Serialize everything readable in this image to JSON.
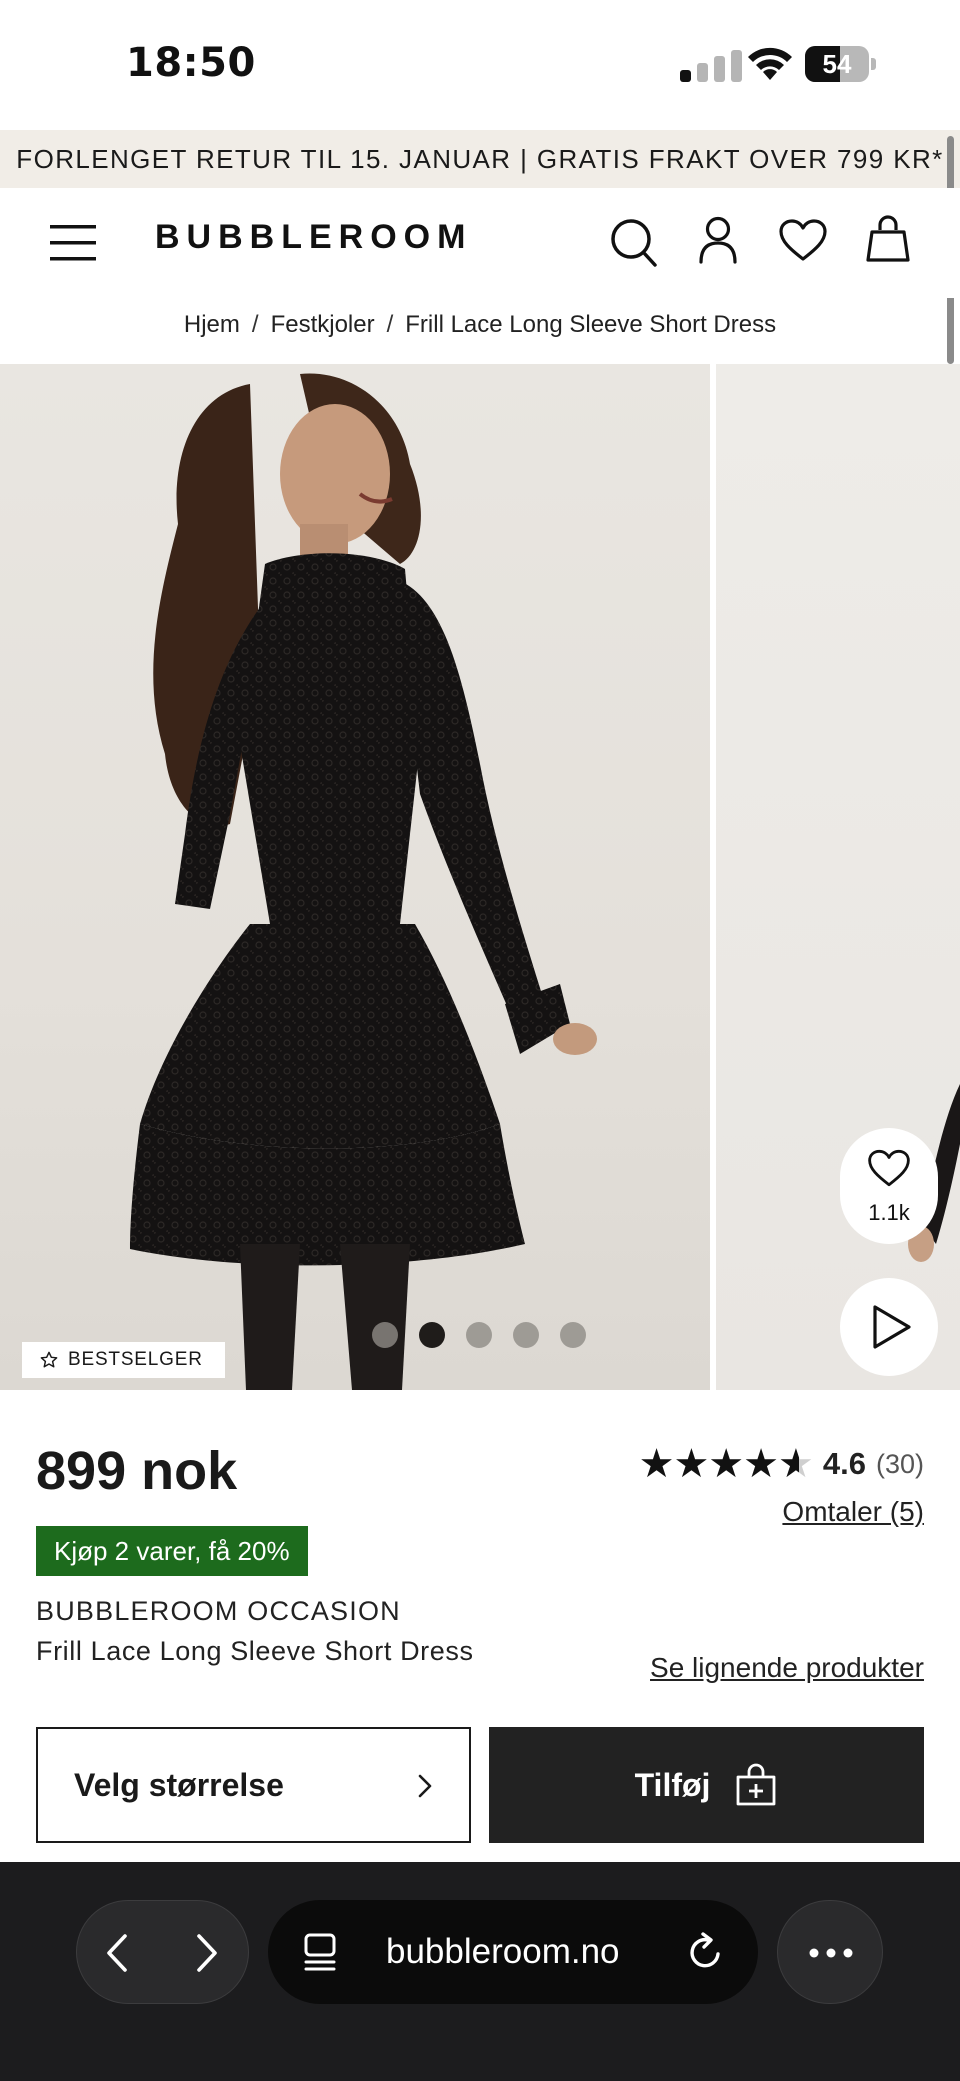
{
  "status_bar": {
    "time": "18:50",
    "battery": "54",
    "battery_level": 0.54
  },
  "promo": {
    "text": "FORLENGET RETUR TIL 15. JANUAR | GRATIS FRAKT OVER 799 KR*"
  },
  "header": {
    "logo": "BUBBLEROOM",
    "icons": [
      "menu-icon",
      "search-icon",
      "account-icon",
      "wishlist-heart-icon",
      "cart-bag-icon"
    ]
  },
  "breadcrumb": {
    "items": [
      "Hjem",
      "Festkjoler",
      "Frill Lace Long Sleeve Short Dress"
    ],
    "separator": "/"
  },
  "gallery": {
    "badge": "BESTSELGER",
    "dots_total": 5,
    "dots_active": 2,
    "favorites_count": "1.1k"
  },
  "product": {
    "price": "899 nok",
    "promo_badge": "Kjøp 2 varer, få 20%",
    "brand": "BUBBLEROOM OCCASION",
    "name": "Frill Lace Long Sleeve Short Dress",
    "rating": "4.6",
    "rating_value": 4.6,
    "rating_max": 5,
    "rating_count": "(30)",
    "reviews_link": "Omtaler (5)",
    "similar_link": "Se lignende produkter"
  },
  "actions": {
    "size_button": "Velg størrelse",
    "add_button": "Tilføj"
  },
  "browser": {
    "url": "bubbleroom.no"
  },
  "colors": {
    "promo_bg": "#f1ede7",
    "badge_green": "#1d6b1d",
    "add_button_bg": "#222222",
    "browser_bg": "#1c1c1e"
  }
}
